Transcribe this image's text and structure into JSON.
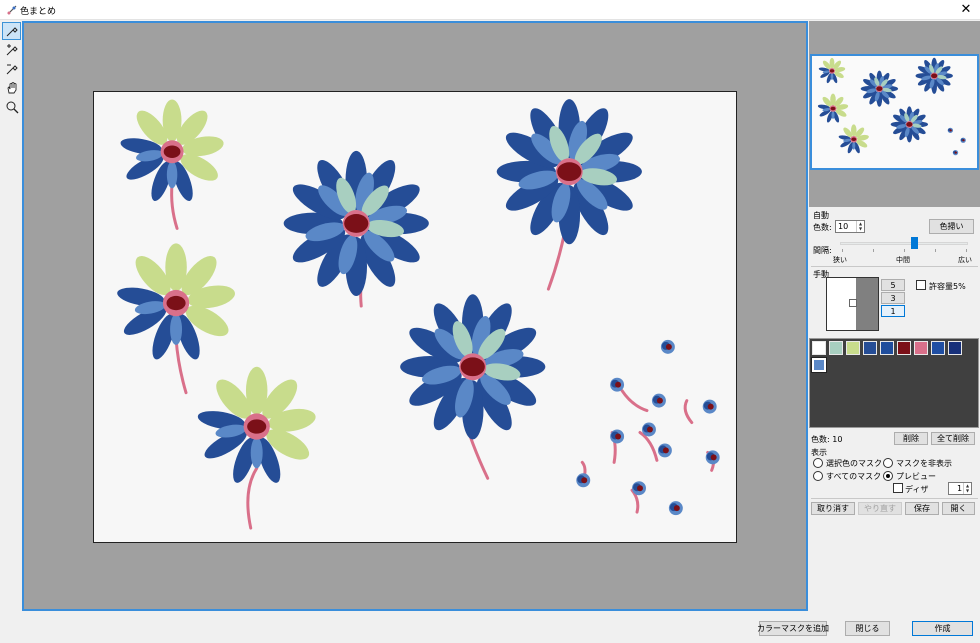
{
  "window": {
    "title": "色まとめ",
    "close_glyph": "✕"
  },
  "tools": [
    {
      "name": "eyedropper-icon",
      "active": true
    },
    {
      "name": "eyedropper-add-icon",
      "active": false
    },
    {
      "name": "eyedropper-remove-icon",
      "active": false
    },
    {
      "name": "hand-icon",
      "active": false
    },
    {
      "name": "zoom-icon",
      "active": false
    }
  ],
  "auto": {
    "heading": "自動",
    "color_count_label": "色数:",
    "color_count_value": "10",
    "reduce_button": "色掃い",
    "spacing_label": "間隔:",
    "slider_value": 0.58,
    "slider_ticks": {
      "narrow": "狭い",
      "middle": "中間",
      "wide": "広い"
    }
  },
  "manual": {
    "heading": "手動",
    "size_buttons": [
      "5",
      "3",
      "1"
    ],
    "selected_size": "1",
    "tolerance_label": "許容量5%"
  },
  "palette": {
    "colors": [
      "#ffffff",
      "#a8cfc0",
      "#c8dc8c",
      "#254d96",
      "#1f4d9c",
      "#7b1018",
      "#d9708a",
      "#1f4ea3",
      "#17307a",
      "#5a88c7"
    ],
    "selected_index": 9
  },
  "palette_footer": {
    "count_label": "色数: 10",
    "delete_button": "削除",
    "delete_all_button": "全て削除"
  },
  "display": {
    "heading": "表示",
    "radios": [
      {
        "label": "選択色のマスク",
        "checked": false
      },
      {
        "label": "マスクを非表示",
        "checked": false
      },
      {
        "label": "すべてのマスク",
        "checked": false
      },
      {
        "label": "プレビュー",
        "checked": true
      }
    ],
    "dither_label": "ディザ",
    "dither_value": "1"
  },
  "actions": {
    "undo": "取り消す",
    "redo": "やり直す",
    "save": "保存",
    "open": "開く"
  },
  "footer": {
    "add_mask": "カラーマスクを追加",
    "close": "閉じる",
    "create": "作成"
  }
}
